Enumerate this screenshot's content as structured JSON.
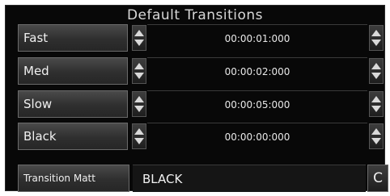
{
  "panel": {
    "title": "Default Transitions"
  },
  "transitions": [
    {
      "label": "Fast",
      "time": "00:00:01:000"
    },
    {
      "label": "Med",
      "time": "00:00:02:000"
    },
    {
      "label": "Slow",
      "time": "00:00:05:000"
    },
    {
      "label": "Black",
      "time": "00:00:00:000"
    }
  ],
  "matte": {
    "label": "Transition Matt",
    "value": "BLACK",
    "button": "C"
  },
  "icons": {
    "spinner": "up-down-spinner-icon"
  }
}
